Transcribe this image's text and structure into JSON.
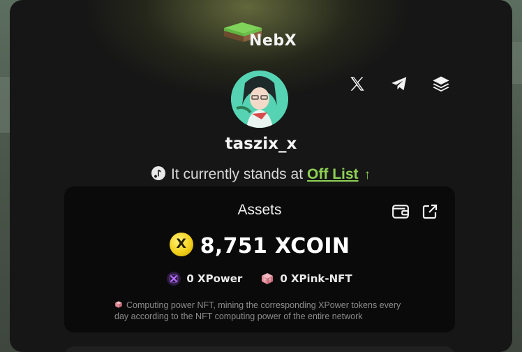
{
  "app": {
    "logo_text": "NebX"
  },
  "profile": {
    "username": "taszix_x"
  },
  "socials": [
    {
      "name": "x-icon"
    },
    {
      "name": "telegram-icon"
    },
    {
      "name": "layers-icon"
    }
  ],
  "standing": {
    "prefix": "It currently stands at",
    "status": "Off List",
    "arrow": "↑"
  },
  "assets": {
    "title": "Assets",
    "amount": "8,751 XCOIN",
    "coin_letter": "X",
    "tokens": [
      {
        "label": "0 XPower"
      },
      {
        "label": "0 XPink-NFT"
      }
    ],
    "note": "Computing power NFT, mining the corresponding XPower tokens every day according to the NFT computing power of the entire network"
  },
  "colors": {
    "accent_green": "#8ed155",
    "coin_gold": "#f2d01c",
    "panel_bg": "#161616"
  }
}
